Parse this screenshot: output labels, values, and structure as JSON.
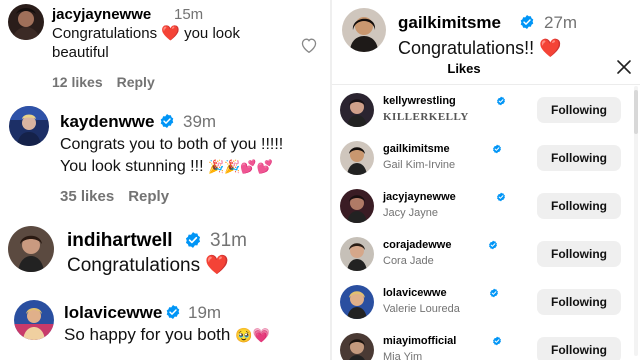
{
  "colors": {
    "verified": "#0095f6",
    "heart": "#e0245e",
    "muted": "#737373",
    "button_bg": "#efefef"
  },
  "comments": [
    {
      "username": "jacyjaynewwe",
      "verified": false,
      "time": "15m",
      "text_before": "Congratulations ",
      "emoji": "❤️",
      "text_after": " you look beautiful",
      "likes": "12 likes",
      "reply": "Reply",
      "heart_icon": "heart-outline-icon"
    },
    {
      "username": "kaydenwwe",
      "verified": true,
      "time": "39m",
      "line1": "Congrats you to both of you !!!!!",
      "line2_text": "You look stunning !!! ",
      "line2_emoji": "🎉🎉💕💕",
      "likes": "35 likes",
      "reply": "Reply"
    },
    {
      "username": "indihartwell",
      "verified": true,
      "time": "31m",
      "text": "Congratulations ",
      "emoji": "❤️"
    },
    {
      "username": "lolavicewwe",
      "verified": true,
      "time": "19m",
      "text": "So happy for you both ",
      "emoji": "🥹💗"
    }
  ],
  "post": {
    "username": "gailkimitsme",
    "verified": true,
    "time": "27m",
    "caption": "Congratulations!! ",
    "caption_emoji": "❤️"
  },
  "likes_sheet": {
    "title": "Likes",
    "close_icon": "close-icon",
    "rows": [
      {
        "username": "kellywrestling",
        "verified": true,
        "full_name": "KILLERKELLY",
        "button": "Following"
      },
      {
        "username": "gailkimitsme",
        "verified": true,
        "full_name": "Gail Kim-Irvine",
        "button": "Following"
      },
      {
        "username": "jacyjaynewwe",
        "verified": true,
        "full_name": "Jacy Jayne",
        "button": "Following"
      },
      {
        "username": "corajadewwe",
        "verified": true,
        "full_name": "Cora Jade",
        "button": "Following"
      },
      {
        "username": "lolavicewwe",
        "verified": true,
        "full_name": "Valerie Loureda",
        "button": "Following"
      },
      {
        "username": "miayimofficial",
        "verified": true,
        "full_name": "Mia Yim",
        "button": "Following"
      }
    ]
  }
}
